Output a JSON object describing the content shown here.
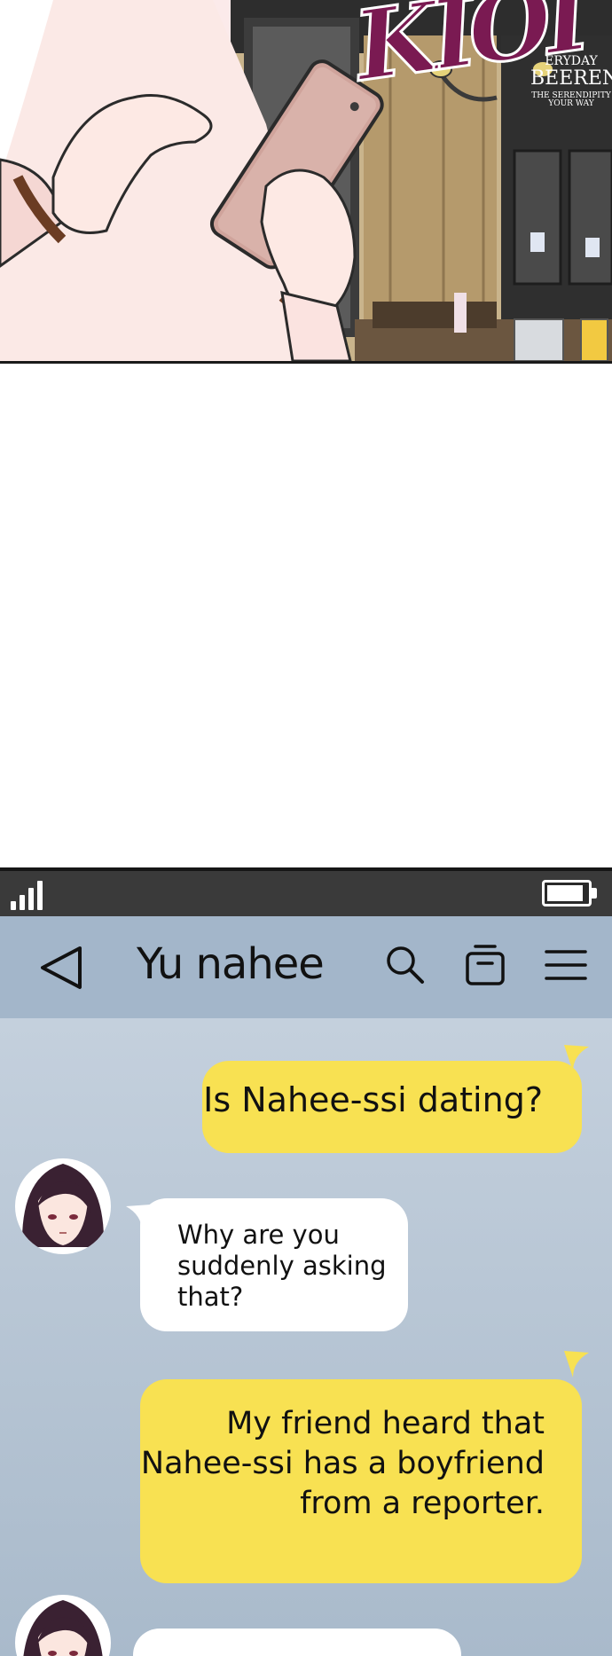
{
  "comic_panel": {
    "sfx_text": "KIOI",
    "sign_line1": "ERYDAY",
    "sign_line2": "BEEREN",
    "sign_line3": "THE SERENDIPITY YOUR WAY"
  },
  "status_bar": {
    "signal_icon": "signal-bars-icon",
    "battery_icon": "battery-icon"
  },
  "header": {
    "title": "Yu nahee",
    "back_icon": "back-arrow-icon",
    "search_icon": "search-icon",
    "drawer_icon": "drawer-icon",
    "menu_icon": "hamburger-menu-icon"
  },
  "messages": [
    {
      "sender": "me",
      "text": "Is Nahee-ssi dating?"
    },
    {
      "sender": "them",
      "lines": [
        "Why are you",
        "suddenly asking",
        "that?"
      ]
    },
    {
      "sender": "me",
      "lines": [
        "My friend heard that",
        "Nahee-ssi has a boyfriend",
        "from a reporter."
      ]
    }
  ],
  "colors": {
    "header_bg": "#a3b6ca",
    "chat_bg": "#b8c7d6",
    "my_bubble": "#f8e152",
    "their_bubble": "#ffffff",
    "status_bar": "#3a3a3a"
  }
}
